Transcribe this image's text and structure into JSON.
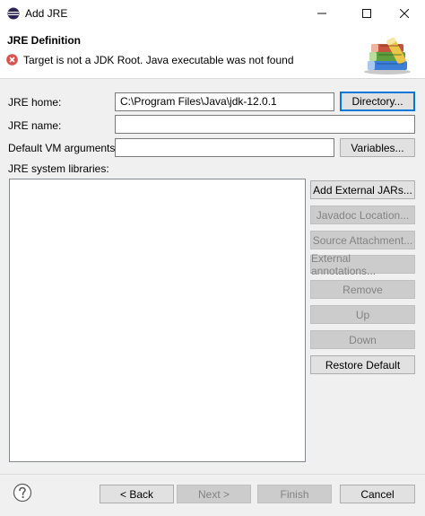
{
  "window": {
    "title": "Add JRE"
  },
  "header": {
    "title": "JRE Definition",
    "message": "Target is not a JDK Root. Java executable was not found"
  },
  "form": {
    "jre_home": {
      "label": "JRE home:",
      "value": "C:\\Program Files\\Java\\jdk-12.0.1"
    },
    "jre_name": {
      "label": "JRE name:",
      "value": ""
    },
    "vm_args": {
      "label": "Default VM arguments:",
      "value": ""
    },
    "libraries_label": "JRE system libraries:",
    "directory_button": "Directory...",
    "variables_button": "Variables..."
  },
  "library_buttons": {
    "add_external_jars": "Add External JARs...",
    "javadoc_location": "Javadoc Location...",
    "source_attachment": "Source Attachment...",
    "external_annotations": "External annotations...",
    "remove": "Remove",
    "up": "Up",
    "down": "Down",
    "restore_default": "Restore Default"
  },
  "footer": {
    "back": "< Back",
    "next": "Next >",
    "finish": "Finish",
    "cancel": "Cancel"
  },
  "colors": {
    "accent": "#0078d7",
    "error": "#d9534f"
  }
}
